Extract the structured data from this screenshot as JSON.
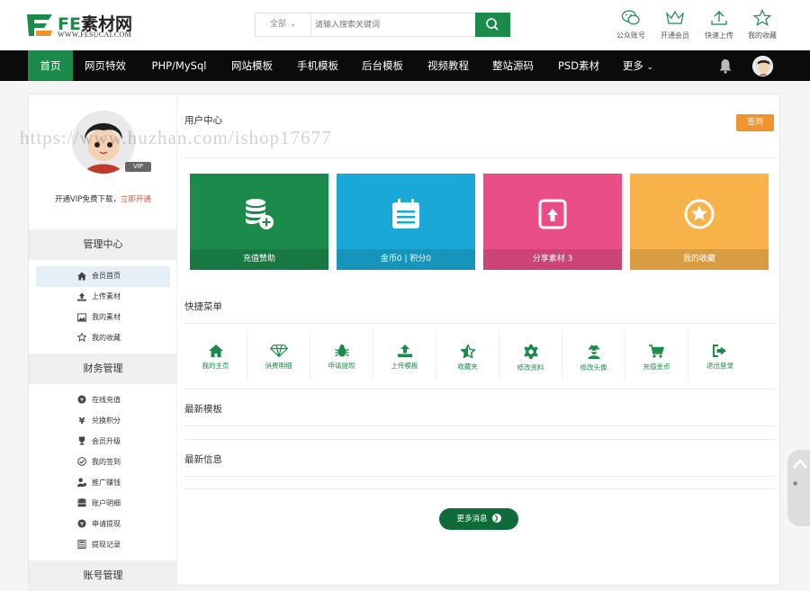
{
  "header": {
    "brand": "素材网",
    "brand_prefix": "FE",
    "url": "WWW.FESUCAI.COM",
    "search": {
      "scope": "全部",
      "placeholder": "请输入搜索关键词"
    },
    "links": [
      {
        "label": "公众账号",
        "icon": "wechat-icon"
      },
      {
        "label": "开通会员",
        "icon": "crown-icon"
      },
      {
        "label": "快速上传",
        "icon": "upload-icon"
      },
      {
        "label": "我的收藏",
        "icon": "star-icon"
      }
    ]
  },
  "nav": {
    "items": [
      "首页",
      "网页特效",
      "PHP/MySql",
      "网站模板",
      "手机模板",
      "后台模板",
      "视频教程",
      "整站源码",
      "PSD素材",
      "更多"
    ],
    "active": "首页"
  },
  "sidebar": {
    "vip_badge": "VIP",
    "vip_text": "开通VIP免费下载，",
    "vip_link": "立即开通",
    "sections": [
      {
        "title": "管理中心",
        "items": [
          {
            "label": "会员首页",
            "icon": "home-icon",
            "active": true
          },
          {
            "label": "上传素材",
            "icon": "upload-icon"
          },
          {
            "label": "我的素材",
            "icon": "image-icon"
          },
          {
            "label": "我的收藏",
            "icon": "star-icon"
          }
        ]
      },
      {
        "title": "财务管理",
        "items": [
          {
            "label": "在线充值",
            "icon": "yen-circle-icon"
          },
          {
            "label": "兑换积分",
            "icon": "yen-icon"
          },
          {
            "label": "会员升级",
            "icon": "trophy-icon"
          },
          {
            "label": "我的签到",
            "icon": "check-circle-icon"
          },
          {
            "label": "推广赚钱",
            "icon": "user-money-icon"
          },
          {
            "label": "账户明细",
            "icon": "database-icon"
          },
          {
            "label": "申请提现",
            "icon": "yen-circle-icon"
          },
          {
            "label": "提现记录",
            "icon": "calculator-icon"
          }
        ]
      },
      {
        "title": "账号管理",
        "items": []
      }
    ]
  },
  "content": {
    "title": "用户中心",
    "checkin": "签到",
    "watermark": "https://www.huzhan.com/ishop17677",
    "cards": [
      {
        "label": "充值赞助",
        "color": "#1b8a4a",
        "icon": "coins-plus-icon"
      },
      {
        "label": "金币0 | 积分0",
        "color": "#1aa9d6",
        "icon": "calendar-icon"
      },
      {
        "label": "分享素材 3",
        "color": "#e94e86",
        "icon": "share-upload-icon"
      },
      {
        "label": "我的收藏",
        "color": "#f7b34a",
        "icon": "star-circle-icon"
      }
    ],
    "quick_title": "快捷菜单",
    "quick": [
      {
        "label": "我的主页",
        "icon": "home-icon"
      },
      {
        "label": "消费明细",
        "icon": "diamond-icon"
      },
      {
        "label": "申请提现",
        "icon": "bug-icon"
      },
      {
        "label": "上传模板",
        "icon": "upload-icon"
      },
      {
        "label": "收藏夹",
        "icon": "star-half-icon"
      },
      {
        "label": "修改资料",
        "icon": "gear-icon"
      },
      {
        "label": "修改头像",
        "icon": "user-secret-icon"
      },
      {
        "label": "充值金币",
        "icon": "cart-icon"
      },
      {
        "label": "退出登录",
        "icon": "signout-icon"
      }
    ],
    "latest_templates": "最新模板",
    "latest_info": "最新信息",
    "more_button": "更多消息"
  },
  "colors": {
    "brand": "#1b8a4a",
    "nav_bg": "#0b0b0b",
    "checkin": "#f0922e"
  }
}
